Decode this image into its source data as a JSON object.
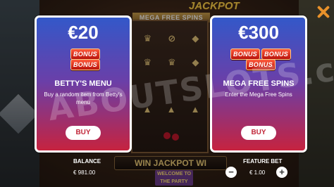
{
  "game": {
    "top_banner": "MEGA FREE SPINS",
    "jackpot_label": "JACKPOT",
    "bottom_marquee": "WIN JACKPOT WI",
    "bottom_sign": "WELCOME TO THE PARTY",
    "watermark": "ABOUTSLOTS.com"
  },
  "features": [
    {
      "price": "€20",
      "bonus_tags": [
        "BONUS",
        "BONUS"
      ],
      "title": "BETTY'S MENU",
      "description": "Buy a random item from Betty's menu",
      "buy_label": "BUY"
    },
    {
      "price": "€300",
      "bonus_tags": [
        "BONUS",
        "BONUS",
        "BONUS"
      ],
      "title": "MEGA FREE SPINS",
      "description": "Enter the Mega Free Spins",
      "buy_label": "BUY"
    }
  ],
  "footer": {
    "balance_label": "BALANCE",
    "balance_value": "€ 981.00",
    "feature_bet_label": "FEATURE BET",
    "feature_bet_value": "€ 1.00",
    "minus_label": "−",
    "plus_label": "+"
  },
  "colors": {
    "card_top": "#3358c9",
    "card_bottom": "#c6233f",
    "buy_text": "#c2283a",
    "close_icon": "#e8912a"
  },
  "icons": {
    "close": "close-icon"
  }
}
